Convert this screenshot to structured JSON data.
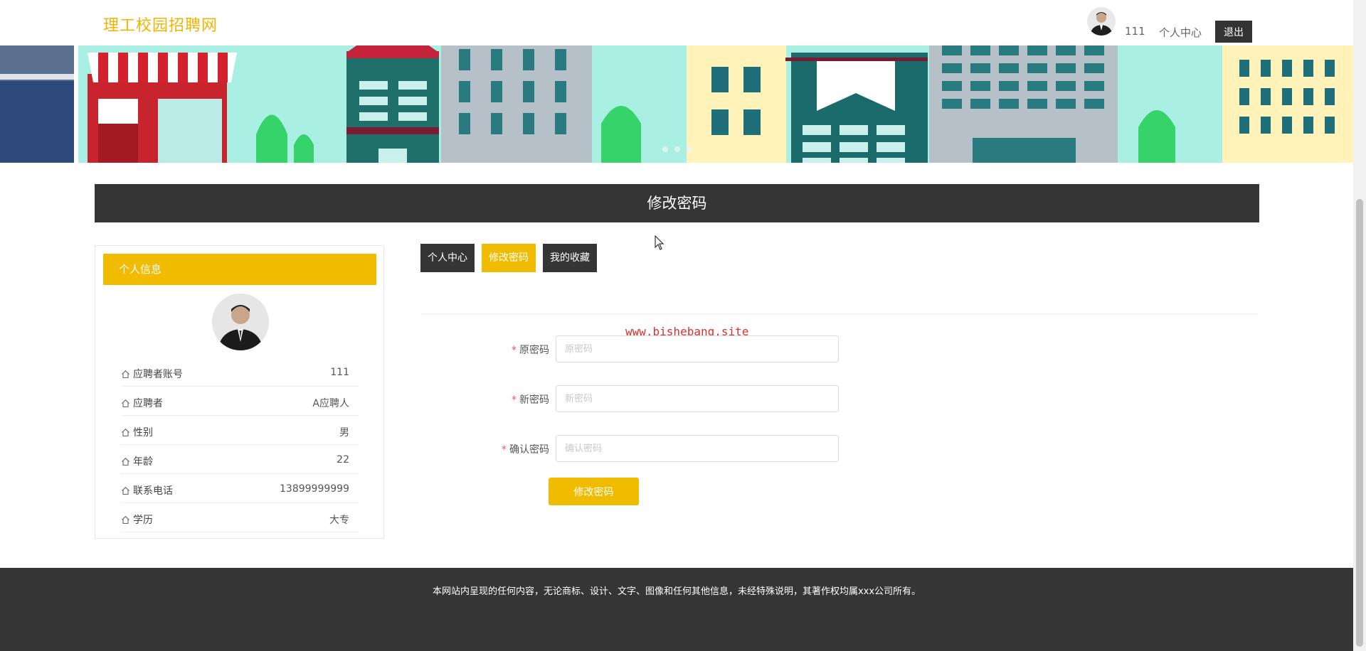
{
  "header": {
    "logo": "理工校园招聘网",
    "username": "111",
    "center_link": "个人中心",
    "logout_label": "退出"
  },
  "page": {
    "title": "修改密码",
    "watermark": "www.bishebang.site"
  },
  "sidebar": {
    "heading": "个人信息",
    "rows": [
      {
        "label": "应聘者账号",
        "value": "111"
      },
      {
        "label": "应聘者",
        "value": "A应聘人"
      },
      {
        "label": "性别",
        "value": "男"
      },
      {
        "label": "年龄",
        "value": "22"
      },
      {
        "label": "联系电话",
        "value": "13899999999"
      },
      {
        "label": "学历",
        "value": "大专"
      }
    ]
  },
  "tabs": [
    {
      "label": "个人中心",
      "active": false
    },
    {
      "label": "修改密码",
      "active": true
    },
    {
      "label": "我的收藏",
      "active": false
    }
  ],
  "form": {
    "required_mark": "*",
    "old_password": {
      "label": "原密码",
      "placeholder": "原密码",
      "value": ""
    },
    "new_password": {
      "label": "新密码",
      "placeholder": "新密码",
      "value": ""
    },
    "confirm_password": {
      "label": "确认密码",
      "placeholder": "确认密码",
      "value": ""
    },
    "submit_label": "修改密码"
  },
  "footer": {
    "text": "本网站内呈现的任何内容，无论商标、设计、文字、图像和任何其他信息，未经特殊说明，其著作权均属xxx公司所有。"
  },
  "colors": {
    "accent": "#f1bc00",
    "dark": "#353535",
    "logo": "#f0b400",
    "watermark": "#d7322b"
  }
}
